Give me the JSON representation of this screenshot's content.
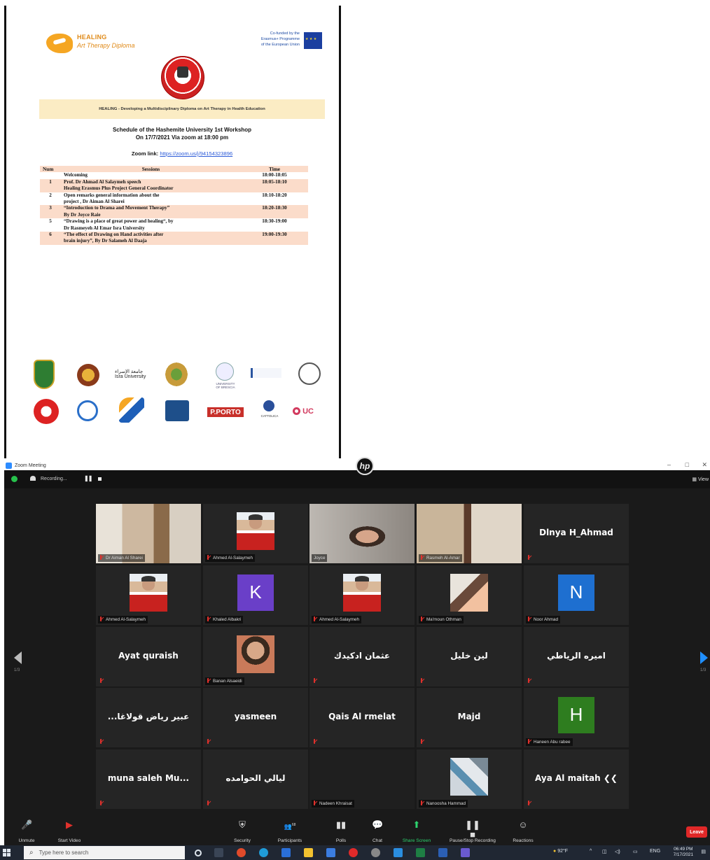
{
  "document": {
    "healing_logo": {
      "line1": "HEALING",
      "line2": "Art Therapy Diploma"
    },
    "eu_text": [
      "Co-funded by the",
      "Erasmus+ Programme",
      "of the European Union"
    ],
    "banner": "HEALING - Developing a Multidisciplinary Diploma on Art Therapy in Health Education",
    "title_line1": "Schedule of the Hashemite University 1st  Workshop",
    "title_line2": "On 17/7/2021 Via zoom at 18:00 pm",
    "zoom_label": "Zoom link: ",
    "zoom_url": "https://zoom.us/j/94154323896",
    "table": {
      "headers": {
        "num": "Num",
        "sessions": "Sessions",
        "time": "Time"
      },
      "rows": [
        {
          "num": "",
          "session": "Welcoming",
          "time": "18:00-18:05",
          "shade": false
        },
        {
          "num": "1",
          "session": "Prof. Dr Ahmad Al Salaymeh speech\nHealing Erasmus Plus Project General Coordinator",
          "time": "18:05-18:10",
          "shade": true
        },
        {
          "num": "2",
          "session": "Open remarks general information about the\nproject , Dr Aiman Al Sharei",
          "time": "18:10-18:20",
          "shade": false
        },
        {
          "num": "3",
          "session": "“Introduction to Drama and Movement Therapy”\nBy Dr Joyce Raie",
          "time": "18:20-18:30",
          "shade": true
        },
        {
          "num": "5",
          "session": "“Drawing is a place of great power and healing“, by\nDr Rasmeyeh Al Emar Isra  University",
          "time": "18:30-19:00",
          "shade": false
        },
        {
          "num": "6",
          "session": "“The effect of Drawing on Hand activities after\nbrain injury”, By Dr Salameh Al Daaja",
          "time": "19:00-19:30",
          "shade": true
        }
      ]
    },
    "partner_text": {
      "isra": "جامعة الإسراء\nIsra University",
      "brescia": "UNIVERSITY\nOF BRESCIA",
      "porto": "P.PORTO",
      "uc": "UC",
      "cattolica": "CATTOLICA"
    }
  },
  "hp_logo": "hp",
  "zoom": {
    "window_title": "Zoom Meeting",
    "recording_label": "Recording...",
    "view_label": "View",
    "page_left": "1/3",
    "page_right": "1/3",
    "participants": [
      {
        "name": "Dr Aiman Al Sharei",
        "kind": "video",
        "big": "",
        "muted": true
      },
      {
        "name": "Ahmed Al-Salaymeh",
        "kind": "photo",
        "big": "",
        "muted": true
      },
      {
        "name": "Joyce",
        "kind": "video",
        "big": "",
        "muted": false,
        "active": true
      },
      {
        "name": "Rasmeh Al-Amar",
        "kind": "video",
        "big": "",
        "muted": true
      },
      {
        "name": "",
        "kind": "text",
        "big": "Dlnya H_Ahmad",
        "muted": true
      },
      {
        "name": "Ahmed Al-Salaymeh",
        "kind": "photo",
        "big": "",
        "muted": true
      },
      {
        "name": "Khaled Albakri",
        "kind": "letter",
        "big": "K",
        "muted": true,
        "color": "#6a3fc8"
      },
      {
        "name": "Ahmed Al-Salaymeh",
        "kind": "photo",
        "big": "",
        "muted": true
      },
      {
        "name": "Ma'moun Othman",
        "kind": "photo2",
        "big": "",
        "muted": true
      },
      {
        "name": "Noor Ahmad",
        "kind": "letter",
        "big": "N",
        "muted": true,
        "color": "#1e6fd0"
      },
      {
        "name": "",
        "kind": "text",
        "big": "Ayat quraish",
        "muted": true
      },
      {
        "name": "Banan Alsaeidi",
        "kind": "photo3",
        "big": "",
        "muted": true
      },
      {
        "name": "",
        "kind": "text",
        "big": "عثمان ادكيدك",
        "muted": true
      },
      {
        "name": "",
        "kind": "text",
        "big": "لين خليل",
        "muted": true
      },
      {
        "name": "",
        "kind": "text",
        "big": "اميره الرياطي",
        "muted": true
      },
      {
        "name": "",
        "kind": "text",
        "big": "...عبير رياض قولاغا",
        "muted": true
      },
      {
        "name": "",
        "kind": "text",
        "big": "yasmeen",
        "muted": true
      },
      {
        "name": "",
        "kind": "text",
        "big": "Qais Al rmelat",
        "muted": true
      },
      {
        "name": "",
        "kind": "text",
        "big": "Majd",
        "muted": true
      },
      {
        "name": "Haneen Abu rabee",
        "kind": "letter",
        "big": "H",
        "muted": true,
        "color": "#2e7d1f"
      },
      {
        "name": "",
        "kind": "text",
        "big": "muna saleh Mu...",
        "muted": true
      },
      {
        "name": "",
        "kind": "text",
        "big": "ليالي الحوامده",
        "muted": true
      },
      {
        "name": "Nadeen Khraisat",
        "kind": "dark",
        "big": "",
        "muted": true
      },
      {
        "name": "Nanoosha Hammad",
        "kind": "photo4",
        "big": "",
        "muted": true
      },
      {
        "name": "",
        "kind": "text",
        "big": "Aya Al maitah ❮❮",
        "muted": true
      }
    ],
    "toolbar": {
      "unmute": "Unmute",
      "start_video": "Start Video",
      "security": "Security",
      "participants": "Participants",
      "participants_count": "68",
      "polls": "Polls",
      "chat": "Chat",
      "share_screen": "Share Screen",
      "recording": "Pause/Stop Recording",
      "reactions": "Reactions",
      "leave": "Leave"
    },
    "colors": {
      "active_speaker": "#9be62c",
      "muted_mic": "#e0312c",
      "leave": "#e02828",
      "share": "#2dd36f"
    }
  },
  "taskbar": {
    "search_placeholder": "Type here to search",
    "weather": "92°F",
    "lang": "ENG",
    "time": "06:49 PM",
    "date": "7/17/2021"
  }
}
